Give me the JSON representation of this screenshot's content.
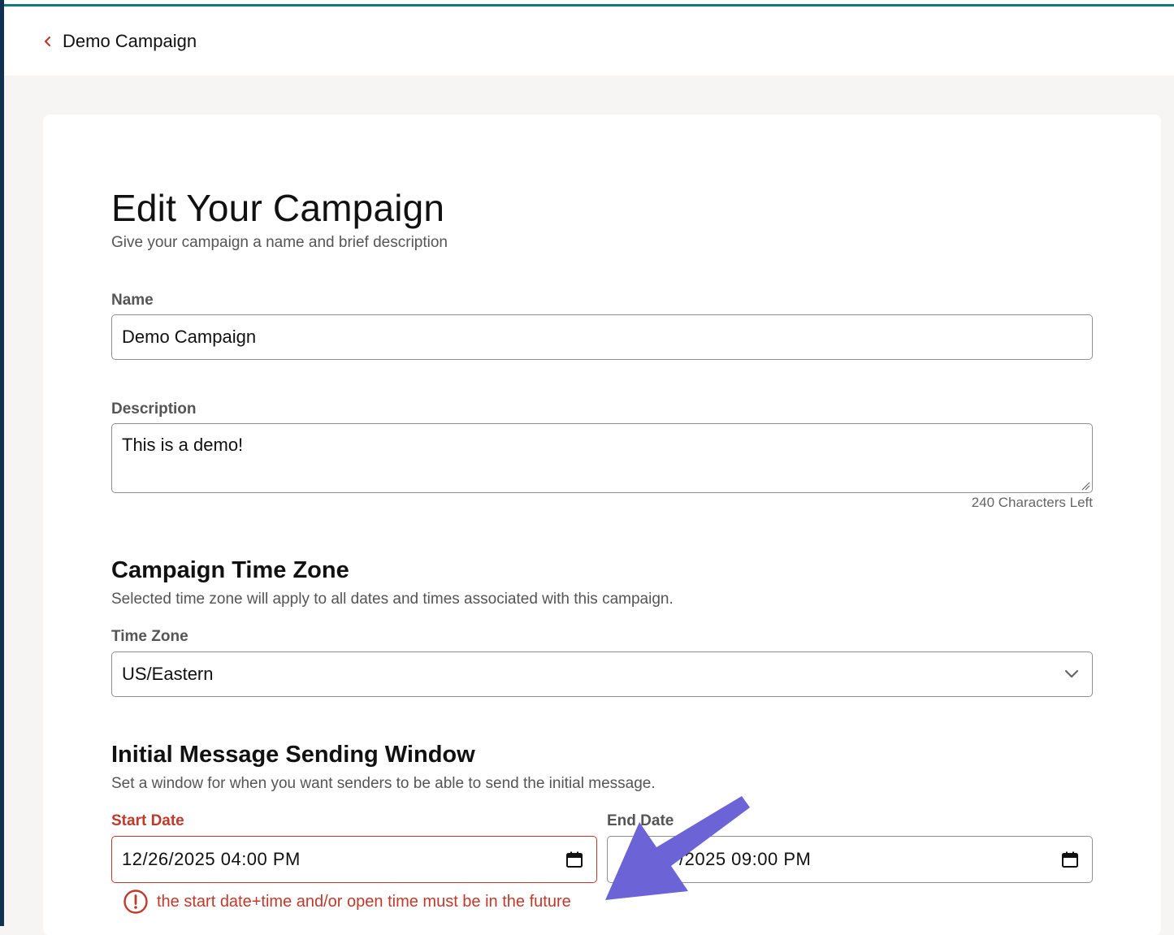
{
  "nav": {
    "back_label": "Demo Campaign"
  },
  "page": {
    "title": "Edit Your Campaign",
    "subtitle": "Give your campaign a name and brief description"
  },
  "name_field": {
    "label": "Name",
    "value": "Demo Campaign"
  },
  "description_field": {
    "label": "Description",
    "value": "This is a demo!",
    "char_count": "240 Characters Left"
  },
  "time_zone_section": {
    "title": "Campaign Time Zone",
    "subtitle": "Selected time zone will apply to all dates and times associated with this campaign.",
    "label": "Time Zone",
    "selected": "US/Eastern"
  },
  "sending_window": {
    "title": "Initial Message Sending Window",
    "subtitle": "Set a window for when you want senders to be able to send the initial message.",
    "start_label": "Start Date",
    "start_value": "12/26/2025 04:00 PM",
    "end_label": "End Date",
    "end_value_visible": "/2025 09:00 PM",
    "error_message": "the start date+time and/or open time must be in the future"
  },
  "colors": {
    "accent_teal": "#0f7a82",
    "error_red": "#c0392b",
    "annotation_arrow": "#6b63d6"
  },
  "icons": {
    "back": "chevron-left-icon",
    "select": "chevron-down-icon",
    "calendar": "calendar-icon",
    "error": "alert-circle-icon"
  }
}
